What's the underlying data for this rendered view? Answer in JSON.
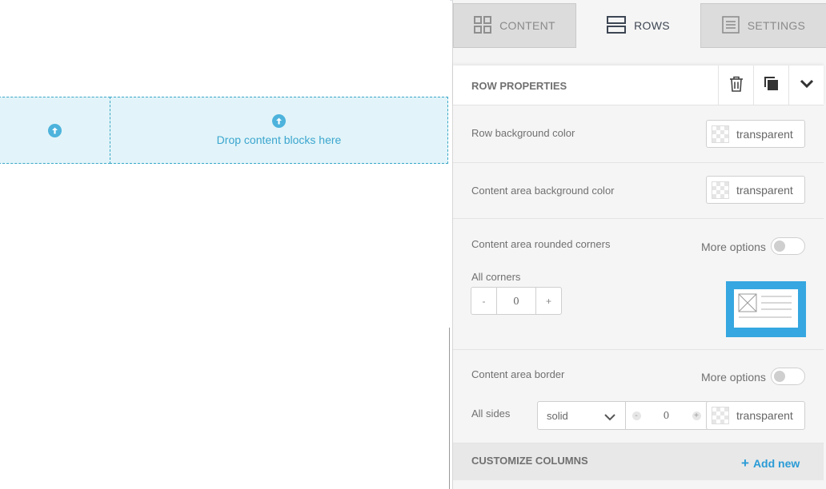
{
  "stage": {
    "drop_label": "Drop content blocks here"
  },
  "tabs": [
    {
      "label": "CONTENT",
      "icon": "grid-icon",
      "active": false
    },
    {
      "label": "ROWS",
      "icon": "rows-icon",
      "active": true
    },
    {
      "label": "SETTINGS",
      "icon": "settings-doc-icon",
      "active": false
    }
  ],
  "row_properties": {
    "title": "ROW PROPERTIES",
    "actions": [
      "trash-icon",
      "duplicate-icon",
      "collapse-chevron-icon"
    ]
  },
  "row_background": {
    "label": "Row background color",
    "value": "transparent"
  },
  "content_background": {
    "label": "Content area background color",
    "value": "transparent"
  },
  "rounded_corners": {
    "label": "Content area rounded corners",
    "more_options": "More options",
    "all_corners_label": "All corners",
    "minus": "-",
    "value": "0",
    "plus": "+"
  },
  "border": {
    "label": "Content area border",
    "more_options": "More options",
    "all_sides_label": "All sides",
    "style_value": "solid",
    "minus": "-",
    "value": "0",
    "plus": "+",
    "color_value": "transparent"
  },
  "customize_columns": {
    "title": "CUSTOMIZE COLUMNS",
    "add_label": "Add new",
    "add_icon": "+"
  },
  "colors": {
    "accent": "#2a9bd6",
    "drop_fill": "#e2f4f9",
    "drop_border": "#3aa7c8",
    "panel_bg": "#f5f5f5"
  }
}
